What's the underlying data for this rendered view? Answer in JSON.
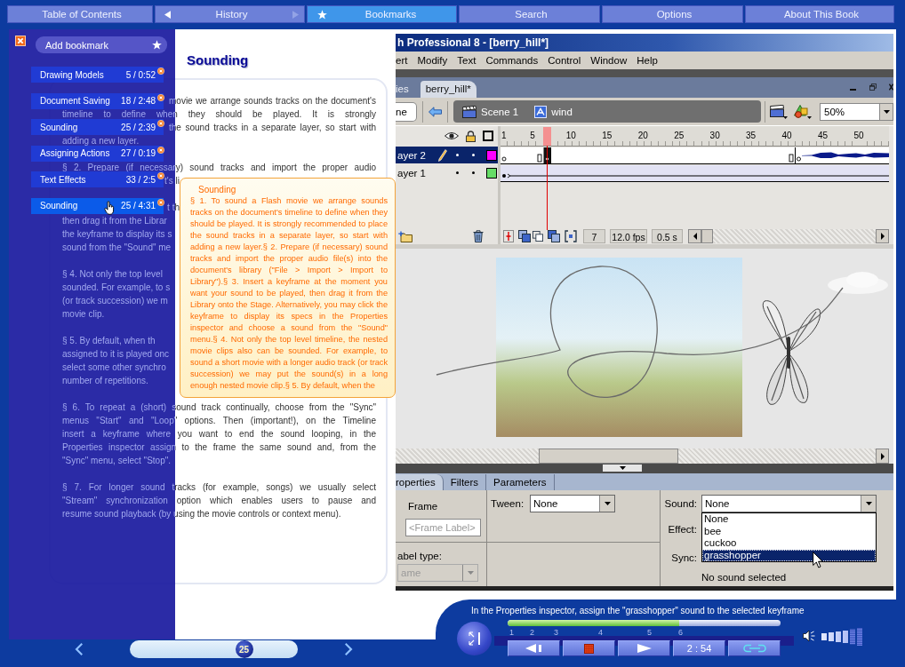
{
  "nav": [
    {
      "label": "Table of Contents",
      "kind": "plain",
      "selected": false
    },
    {
      "label": "History",
      "kind": "history",
      "selected": false,
      "back_disabled": false,
      "forward_disabled": true
    },
    {
      "label": "Bookmarks",
      "kind": "star",
      "selected": true
    },
    {
      "label": "Search",
      "kind": "plain",
      "selected": false
    },
    {
      "label": "Options",
      "kind": "plain",
      "selected": false
    },
    {
      "label": "About This Book",
      "kind": "plain",
      "selected": false
    }
  ],
  "bookmarks": {
    "add_label": "Add bookmark",
    "items": [
      {
        "title": "Drawing Models",
        "info": "5 / 0:52",
        "selected": false
      },
      {
        "title": "Document Saving",
        "info": "18 / 2:48",
        "selected": false
      },
      {
        "title": "Sounding",
        "info": "25 / 2:39",
        "selected": false
      },
      {
        "title": "Assigning Actions",
        "info": "27 / 0:19",
        "selected": false
      },
      {
        "title": "Text Effects",
        "info": "33 / 2:5",
        "selected": false
      },
      {
        "title": "Sounding",
        "info": "25 / 4:31",
        "selected": true
      }
    ]
  },
  "document": {
    "title": "Sounding",
    "paragraphs": [
      {
        "lines": [
          {
            "text": "movie we arrange sounds tracks on the document's",
            "kind": "rest"
          },
          {
            "text": "timeline to define when they should be played. It is strongly",
            "kind": "full"
          },
          {
            "text": "the sound tracks in a separate layer, so start with",
            "kind": "rest"
          },
          {
            "text": "adding a new layer.",
            "kind": "part"
          }
        ]
      },
      {
        "lines": [
          {
            "text": "§ 2. Prepare (if necessary) sound tracks and import the proper audio",
            "kind": "full"
          },
          {
            "text": "t's li",
            "kind": "tail"
          }
        ]
      },
      {
        "lines": [
          {
            "text": "t th",
            "kind": "tail"
          },
          {
            "text": "then drag it from the Librar",
            "kind": "part"
          },
          {
            "text": "the keyframe to display its s",
            "kind": "part"
          },
          {
            "text": "sound from the \"Sound\" me",
            "kind": "part"
          }
        ]
      },
      {
        "lines": [
          {
            "text": "§ 4. Not only the top level",
            "kind": "part"
          },
          {
            "text": "sounded. For example, to s",
            "kind": "part"
          },
          {
            "text": "(or track succession) we m",
            "kind": "part"
          },
          {
            "text": "movie clip.",
            "kind": "part"
          }
        ]
      },
      {
        "lines": [
          {
            "text": "§ 5. By default, when th",
            "kind": "part"
          },
          {
            "text": "assigned to it is played onc",
            "kind": "part"
          },
          {
            "text": "select some other synchro",
            "kind": "part"
          },
          {
            "text": "number of repetitions.",
            "kind": "part"
          }
        ]
      },
      {
        "lines": [
          {
            "text": "§ 6. To repeat a (short) sound track continually, choose from the \"Sync\"",
            "kind": "full"
          },
          {
            "text": "menus \"Start\" and \"Loop\" options. Then (important!), on the Timeline",
            "kind": "full"
          },
          {
            "text": "insert a keyframe where you want to end the sound looping, in the",
            "kind": "full"
          },
          {
            "text": "Properties inspector assign to the frame the same sound and, from the",
            "kind": "full"
          },
          {
            "text": "\"Sync\" menu, select \"Stop\".",
            "kind": "part"
          }
        ]
      },
      {
        "lines": [
          {
            "text": "§ 7. For longer sound tracks (for example, songs) we usually select",
            "kind": "full"
          },
          {
            "text": "\"Stream\" synchronization option which enables users to pause and",
            "kind": "full"
          },
          {
            "text": "resume sound playback (by using the movie controls or context menu).",
            "kind": "part"
          }
        ]
      }
    ]
  },
  "tooltip": {
    "title": "Sounding",
    "text": "§ 1. To sound a Flash movie we arrange sounds tracks on the document's timeline to define when they should be played. It is strongly recommended to place the sound tracks in a separate layer, so start with adding a new layer.§ 2. Prepare (if necessary) sound tracks and import the proper audio file(s) into the document's library (\"File > Import > Import to Library\").§ 3. Insert a keyframe at the moment you want your sound to be played, then drag it from the Library onto the Stage. Alternatively, you may click the keyframe to display its specs in the Properties inspector and choose a sound from the \"Sound\" menu.§ 4. Not only the top level timeline, the nested movie clips also can be sounded. For example, to sound a short movie with a longer audio track (or track succession) we may put the sound(s) in a long enough nested movie clip.§ 5. By default, when the"
  },
  "app": {
    "title": "h Professional 8 - [berry_hill*]",
    "menu": [
      "ert",
      "Modify",
      "Text",
      "Commands",
      "Control",
      "Window",
      "Help"
    ],
    "doc_tabs": [
      {
        "label": "ies",
        "selected": false
      },
      {
        "label": "berry_hill*",
        "selected": true
      }
    ],
    "scene_field": "ne",
    "breadcrumb": [
      {
        "label": "Scene 1",
        "kind": "scene"
      },
      {
        "label": "wind",
        "kind": "symbol"
      }
    ],
    "zoom": "50%",
    "timeline": {
      "ruler": [
        "1",
        "5",
        "10",
        "15",
        "20",
        "25",
        "30",
        "35",
        "40",
        "45",
        "50"
      ],
      "playhead": {
        "level": 0.11
      },
      "layers": [
        {
          "name": "ayer 2",
          "selected": true,
          "color": "#ff00ff",
          "kind": "sound"
        },
        {
          "name": "ayer 1",
          "selected": false,
          "color": "#66dd66",
          "kind": "motion"
        }
      ],
      "frame": "7",
      "fps": "12.0 fps",
      "time": "0.5 s"
    },
    "properties": {
      "tabs": [
        {
          "label": "roperties",
          "selected": true
        },
        {
          "label": "Filters",
          "selected": false
        },
        {
          "label": "Parameters",
          "selected": false
        }
      ],
      "frame_label": "Frame",
      "frame_placeholder": "<Frame Label>",
      "label_type_label": "abel type:",
      "label_type_value": "ame",
      "label_type_disabled": true,
      "tween_label": "Tween:",
      "tween_value": "None",
      "sound_label": "Sound:",
      "sound_value": "None",
      "sound_options": [
        {
          "label": "None",
          "selected": false
        },
        {
          "label": "bee",
          "selected": false
        },
        {
          "label": "cuckoo",
          "selected": false
        },
        {
          "label": "grasshopper",
          "selected": true
        }
      ],
      "effect_label": "Effect:",
      "sync_label": "Sync:",
      "status": "No sound selected"
    }
  },
  "player": {
    "caption": "In the Properties inspector, assign the \"grasshopper\" sound to the selected keyframe",
    "progress": {
      "level": 0.63
    },
    "steps": [
      "1",
      "2",
      "3",
      "4",
      "5",
      "6"
    ],
    "time": "2 : 54",
    "volume": {
      "level": 0.67
    }
  },
  "pager": {
    "page": "25",
    "level": 0.68
  }
}
